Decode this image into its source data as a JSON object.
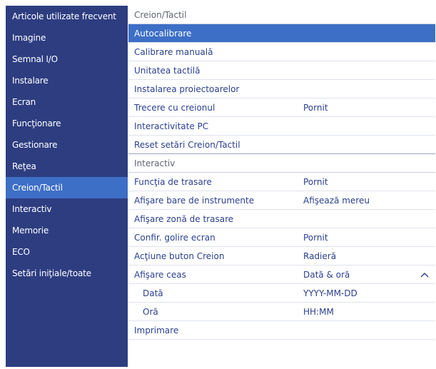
{
  "sidebar": {
    "items": [
      {
        "label": "Articole utilizate frecvent"
      },
      {
        "label": "Imagine"
      },
      {
        "label": "Semnal I/O"
      },
      {
        "label": "Instalare"
      },
      {
        "label": "Ecran"
      },
      {
        "label": "Funcţionare"
      },
      {
        "label": "Gestionare"
      },
      {
        "label": "Reţea"
      },
      {
        "label": "Creion/Tactil",
        "active": true
      },
      {
        "label": "Interactiv"
      },
      {
        "label": "Memorie"
      },
      {
        "label": "ECO"
      },
      {
        "label": "Setări iniţiale/toate"
      }
    ]
  },
  "main": {
    "section1": {
      "header": "Creion/Tactil",
      "rows": [
        {
          "label": "Autocalibrare",
          "value": "",
          "selected": true
        },
        {
          "label": "Calibrare manuală",
          "value": ""
        },
        {
          "label": "Unitatea tactilă",
          "value": ""
        },
        {
          "label": "Instalarea proiectoarelor",
          "value": ""
        },
        {
          "label": "Trecere cu creionul",
          "value": "Pornit"
        },
        {
          "label": "Interactivitate PC",
          "value": ""
        },
        {
          "label": "Reset setări Creion/Tactil",
          "value": ""
        }
      ]
    },
    "section2": {
      "header": "Interactiv",
      "rows": [
        {
          "label": "Funcţia de trasare",
          "value": "Pornit"
        },
        {
          "label": "Afişare bare de instrumente",
          "value": "Afişează mereu"
        },
        {
          "label": "Afişare zonă de trasare",
          "value": ""
        },
        {
          "label": "Confir. golire ecran",
          "value": "Pornit"
        },
        {
          "label": "Acţiune buton Creion",
          "value": "Radieră"
        },
        {
          "label": "Afişare ceas",
          "value": "Dată & oră",
          "expanded": true
        },
        {
          "label": "Dată",
          "value": "YYYY-MM-DD",
          "sub": true
        },
        {
          "label": "Oră",
          "value": "HH:MM",
          "sub": true
        },
        {
          "label": "Imprimare",
          "value": ""
        }
      ]
    }
  },
  "colors": {
    "sidebar_bg": "#2d3d80",
    "accent": "#3d6fc6",
    "text": "#2a3f8f",
    "header_text": "#5f6570"
  },
  "icons": {
    "collapse": "chevron-up-icon"
  }
}
